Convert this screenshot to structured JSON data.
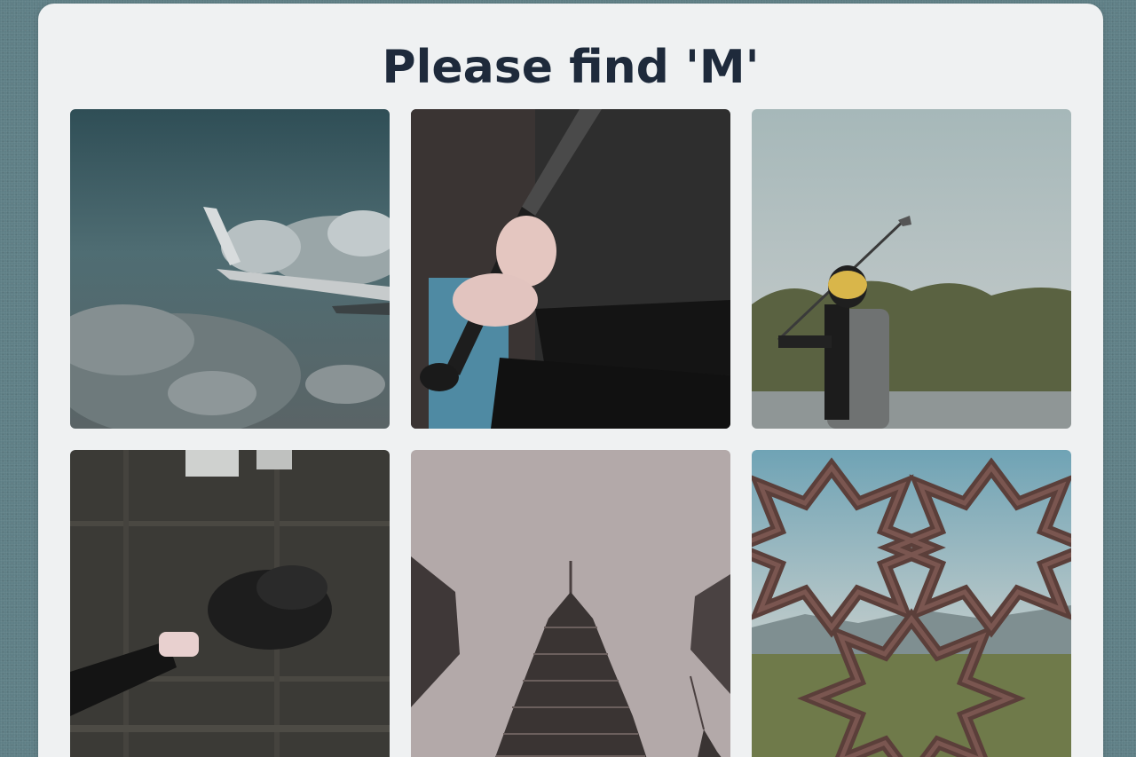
{
  "challenge": {
    "title": "Please find 'M'"
  },
  "tiles": [
    {
      "name": "tile-airplane-wing-clouds"
    },
    {
      "name": "tile-baseball-bat-grip"
    },
    {
      "name": "tile-golfer-swing"
    },
    {
      "name": "tile-baseball-glove"
    },
    {
      "name": "tile-skyscraper-spire"
    },
    {
      "name": "tile-geometric-lattice"
    }
  ]
}
